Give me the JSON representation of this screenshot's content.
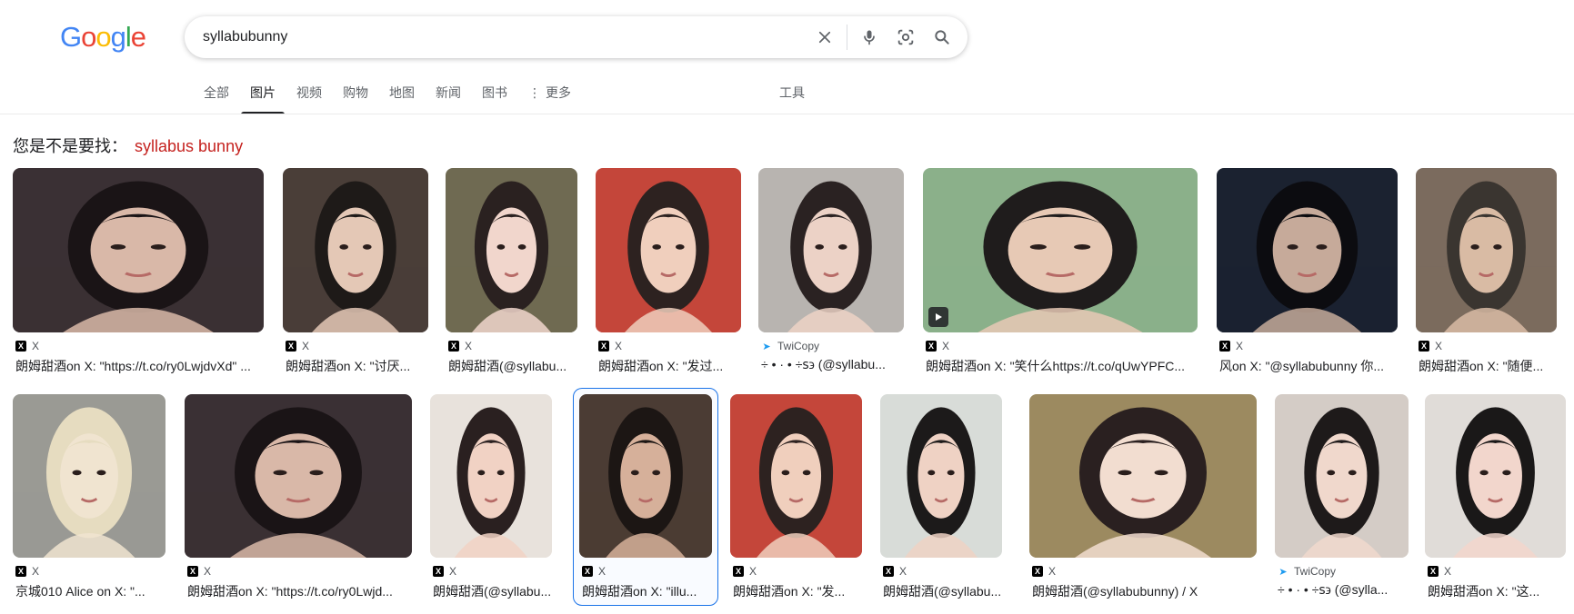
{
  "header": {
    "logo": [
      "G",
      "o",
      "o",
      "g",
      "l",
      "e"
    ],
    "search_value": "syllabubunny",
    "icons": [
      "clear-icon",
      "microphone-icon",
      "lens-camera-icon",
      "search-icon"
    ]
  },
  "tabs": [
    {
      "label": "全部",
      "active": false
    },
    {
      "label": "图片",
      "active": true
    },
    {
      "label": "视频",
      "active": false
    },
    {
      "label": "购物",
      "active": false
    },
    {
      "label": "地图",
      "active": false
    },
    {
      "label": "新闻",
      "active": false
    },
    {
      "label": "图书",
      "active": false
    },
    {
      "label": "更多",
      "active": false,
      "icon": "more-vert-icon"
    }
  ],
  "tools_label": "工具",
  "suggestion": {
    "prefix": "您是不是要找：",
    "query": "syllabus bunny"
  },
  "row1": [
    {
      "source": "X",
      "source_icon": "x-logo-icon",
      "title": "朗姆甜酒on X: \"https://t.co/ry0LwjdvXd\" ...",
      "colors": [
        "#3a3034",
        "#d9b8a8",
        "#1a1416"
      ]
    },
    {
      "source": "X",
      "source_icon": "x-logo-icon",
      "title": "朗姆甜酒on X: \"讨厌...",
      "colors": [
        "#4a3e38",
        "#e4c8b6",
        "#1e1a18"
      ]
    },
    {
      "source": "X",
      "source_icon": "x-logo-icon",
      "title": "朗姆甜酒(@syllabu...",
      "colors": [
        "#6f6a52",
        "#f1d6cc",
        "#2a2120"
      ]
    },
    {
      "source": "X",
      "source_icon": "x-logo-icon",
      "title": "朗姆甜酒on X: \"发过...",
      "colors": [
        "#c4463a",
        "#f0cfbd",
        "#2d2220"
      ]
    },
    {
      "source": "TwiCopy",
      "source_icon": "twicopy-icon",
      "title": "÷ • · • ÷ꜱ϶ (@syllabu...",
      "colors": [
        "#b8b4b0",
        "#ecd2c6",
        "#2a2222"
      ]
    },
    {
      "source": "X",
      "source_icon": "x-logo-icon",
      "title": "朗姆甜酒on X: \"笑什么https://t.co/qUwYPFC...",
      "colors": [
        "#8bb08a",
        "#e7c9b5",
        "#1f1c1c"
      ],
      "video": true
    },
    {
      "source": "X",
      "source_icon": "x-logo-icon",
      "title": "风on X: \"@syllabubunny 你...",
      "colors": [
        "#1b2230",
        "#c6aa9a",
        "#0c0c10"
      ]
    },
    {
      "source": "X",
      "source_icon": "x-logo-icon",
      "title": "朗姆甜酒on X: \"随便...",
      "colors": [
        "#7b6b5e",
        "#d9bba4",
        "#3a3530"
      ]
    }
  ],
  "row2": [
    {
      "source": "X",
      "source_icon": "x-logo-icon",
      "title": "京城010 Alice on X: \"...",
      "colors": [
        "#9a9a94",
        "#f0e4d0",
        "#e6dcc0"
      ]
    },
    {
      "source": "X",
      "source_icon": "x-logo-icon",
      "title": "朗姆甜酒on X: \"https://t.co/ry0Lwjd...",
      "colors": [
        "#3a3034",
        "#d9b8a8",
        "#1a1416"
      ]
    },
    {
      "source": "X",
      "source_icon": "x-logo-icon",
      "title": "朗姆甜酒(@syllabu...",
      "colors": [
        "#e8e2dc",
        "#f1d2c4",
        "#2a2020"
      ]
    },
    {
      "source": "X",
      "source_icon": "x-logo-icon",
      "title": "朗姆甜酒on X: \"illu...",
      "colors": [
        "#4b3c34",
        "#d6b09a",
        "#1c1614"
      ],
      "selected": true
    },
    {
      "source": "X",
      "source_icon": "x-logo-icon",
      "title": "朗姆甜酒on X: \"发...",
      "colors": [
        "#c4463a",
        "#f0cfbd",
        "#2d2220"
      ]
    },
    {
      "source": "X",
      "source_icon": "x-logo-icon",
      "title": "朗姆甜酒(@syllabu...",
      "colors": [
        "#d8dcd8",
        "#efd2c4",
        "#1c1a1a"
      ]
    },
    {
      "source": "X",
      "source_icon": "x-logo-icon",
      "title": "朗姆甜酒(@syllabubunny) / X",
      "colors": [
        "#9c8a60",
        "#f2ddd0",
        "#2a2020"
      ]
    },
    {
      "source": "TwiCopy",
      "source_icon": "twicopy-icon",
      "title": "÷ • · • ÷ꜱ϶ (@sylla...",
      "colors": [
        "#d4ccc6",
        "#f0d8cc",
        "#1e1a1a"
      ]
    },
    {
      "source": "X",
      "source_icon": "x-logo-icon",
      "title": "朗姆甜酒on X: \"这...",
      "colors": [
        "#e0dcd8",
        "#f2d6cc",
        "#1a1818"
      ]
    }
  ]
}
